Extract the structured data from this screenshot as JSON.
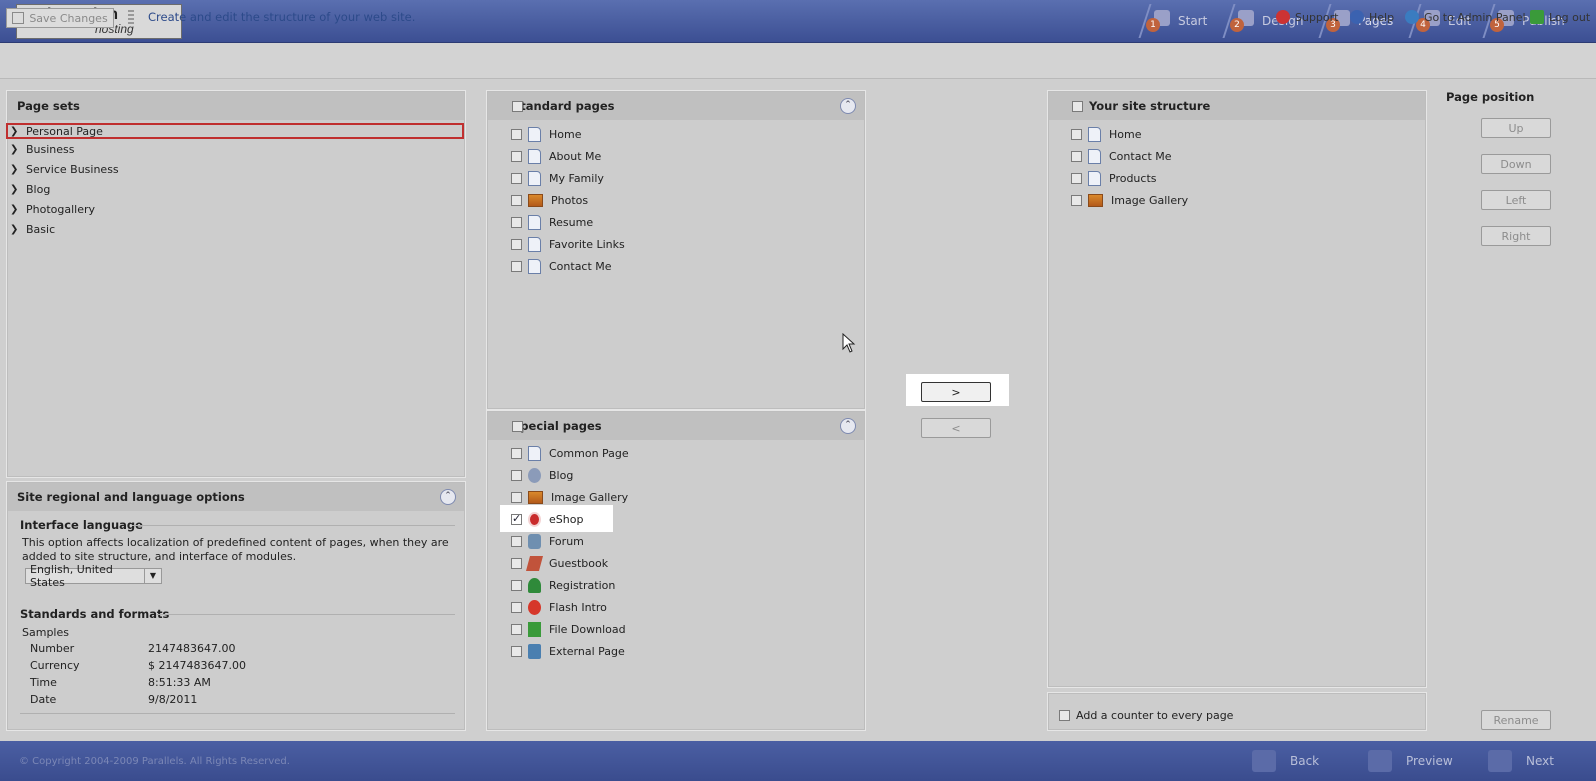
{
  "header": {
    "logo_main": "inmotion",
    "logo_sub": "hosting",
    "steps": [
      {
        "num": "1",
        "label": "Start"
      },
      {
        "num": "2",
        "label": "Design"
      },
      {
        "num": "3",
        "label": "Pages"
      },
      {
        "num": "4",
        "label": "Edit"
      },
      {
        "num": "5",
        "label": "Publish"
      }
    ]
  },
  "toolbar": {
    "save_label": "Save Changes",
    "description": "Create and edit the structure of your web site.",
    "links": [
      "Support",
      "Help",
      "Go to Admin Panel",
      "Log out"
    ]
  },
  "page_sets": {
    "title": "Page sets",
    "items": [
      "Personal Page",
      "Business",
      "Service Business",
      "Blog",
      "Photogallery",
      "Basic"
    ]
  },
  "regional": {
    "title": "Site regional and language options",
    "interface_language_title": "Interface language",
    "interface_language_desc": "This option affects localization of predefined content of pages, when they are added to site structure, and interface of modules.",
    "language_value": "English, United States",
    "formats_title": "Standards and formats",
    "samples_label": "Samples",
    "samples": [
      {
        "label": "Number",
        "value": "2147483647.00"
      },
      {
        "label": "Currency",
        "value": "$ 2147483647.00"
      },
      {
        "label": "Time",
        "value": "8:51:33 AM"
      },
      {
        "label": "Date",
        "value": "9/8/2011"
      }
    ]
  },
  "standard_pages": {
    "title": "Standard pages",
    "items": [
      "Home",
      "About Me",
      "My Family",
      "Photos",
      "Resume",
      "Favorite Links",
      "Contact Me"
    ]
  },
  "special_pages": {
    "title": "Special pages",
    "items": [
      "Common Page",
      "Blog",
      "Image Gallery",
      "eShop",
      "Forum",
      "Guestbook",
      "Registration",
      "Flash Intro",
      "File Download",
      "External Page"
    ]
  },
  "transfer": {
    "add_label": ">",
    "remove_label": "<"
  },
  "site_structure": {
    "title": "Your site structure",
    "items": [
      "Home",
      "Contact Me",
      "Products",
      "Image Gallery"
    ],
    "counter_label": "Add a counter to every page"
  },
  "page_position": {
    "title": "Page position",
    "up": "Up",
    "down": "Down",
    "left": "Left",
    "right": "Right",
    "rename": "Rename"
  },
  "footer": {
    "copyright": "© Copyright 2004-2009 Parallels. All Rights Reserved.",
    "back": "Back",
    "preview": "Preview",
    "next": "Next"
  }
}
